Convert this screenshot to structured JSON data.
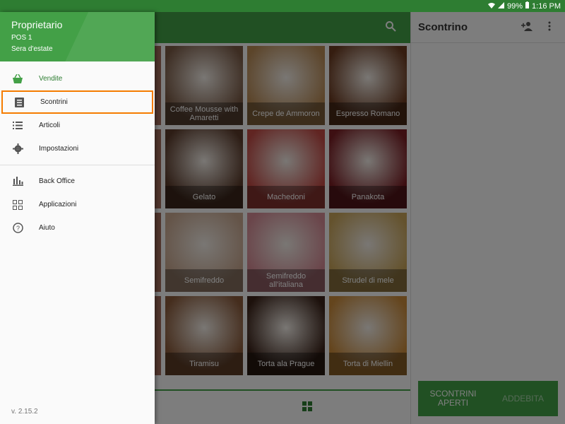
{
  "status_bar": {
    "battery": "99%",
    "time": "1:16 PM"
  },
  "drawer": {
    "owner": "Proprietario",
    "pos": "POS 1",
    "shift": "Sera d'estate",
    "items": [
      {
        "label": "Vendite",
        "icon": "basket-icon"
      },
      {
        "label": "Scontrini",
        "icon": "receipt-icon"
      },
      {
        "label": "Articoli",
        "icon": "list-icon"
      },
      {
        "label": "Impostazioni",
        "icon": "gear-icon"
      },
      {
        "label": "Back Office",
        "icon": "bar-chart-icon"
      },
      {
        "label": "Applicazioni",
        "icon": "apps-icon"
      },
      {
        "label": "Aiuto",
        "icon": "help-icon"
      }
    ],
    "version": "v. 2.15.2"
  },
  "grid": {
    "items": [
      {
        "label": "Coffee Mousse with Amaretti",
        "color": "#7a5a45"
      },
      {
        "label": "Crepe de Ammoron",
        "color": "#b88a55"
      },
      {
        "label": "Espresso Romano",
        "color": "#6b3b21"
      },
      {
        "label": "Gelato",
        "color": "#5a3a2a"
      },
      {
        "label": "Machedoni",
        "color": "#c24a45"
      },
      {
        "label": "Panakota",
        "color": "#7a1f25"
      },
      {
        "label": "Semifreddo",
        "color": "#c9a890"
      },
      {
        "label": "Semifreddo all'italiana",
        "color": "#d58a94"
      },
      {
        "label": "Strudel di mele",
        "color": "#c9a55a"
      },
      {
        "label": "Tiramisu",
        "color": "#8a5a3a"
      },
      {
        "label": "Torta ala Prague",
        "color": "#3a2218"
      },
      {
        "label": "Torta di Miellin",
        "color": "#c98a3a"
      }
    ]
  },
  "receipt": {
    "title": "Scontrino",
    "open_receipts": "SCONTRINI APERTI",
    "charge": "ADDEBITA"
  },
  "colors": {
    "primary": "#43a047",
    "highlight": "#f57c00"
  }
}
